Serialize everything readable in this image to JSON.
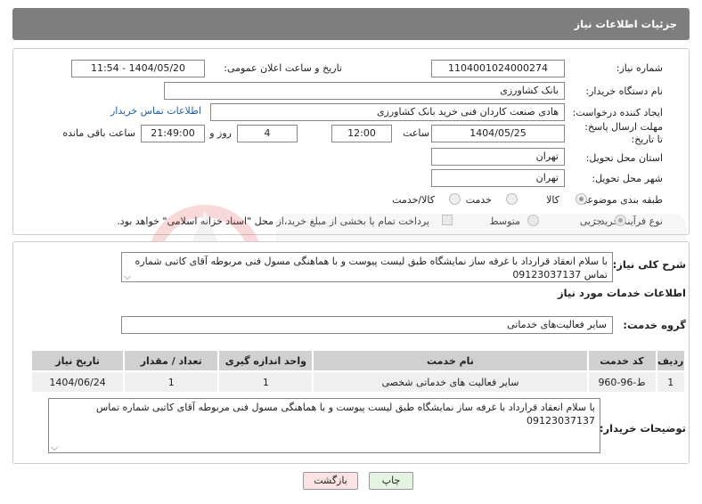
{
  "header": {
    "title": "جزئیات اطلاعات نیاز"
  },
  "form": {
    "need_number_label": "شماره نیاز:",
    "need_number": "1104001024000274",
    "announce_label": "تاریخ و ساعت اعلان عمومی:",
    "announce_value": "1404/05/20 - 11:54",
    "buyer_org_label": "نام دستگاه خریدار:",
    "buyer_org": "بانک کشاورزی",
    "creator_label": "ایجاد کننده درخواست:",
    "creator": "هادی صنعت کاردان فنی خرید بانک کشاورزی",
    "contact_link": "اطلاعات تماس خریدار",
    "deadline_label": "مهلت ارسال پاسخ: تا تاریخ:",
    "deadline_date": "1404/05/25",
    "time_label": "ساعت",
    "deadline_time": "12:00",
    "days_value": "4",
    "days_label": "روز و",
    "remaining_time": "21:49:00",
    "remaining_label": "ساعت باقی مانده",
    "province_label": "استان محل تحویل:",
    "province": "تهران",
    "city_label": "شهر محل تحویل:",
    "city": "تهران",
    "category_label": "طبقه بندی موضوعی:",
    "category_options": [
      "کالا",
      "خدمت",
      "کالا/خدمت"
    ],
    "process_label": "نوع فرآیند خرید :",
    "process_options": [
      "جزیی",
      "متوسط"
    ],
    "payment_note": "پرداخت تمام یا بخشی از مبلغ خرید،از محل \"اسناد خزانه اسلامی\" خواهد بود."
  },
  "details": {
    "desc_label": "شرح کلی نیاز:",
    "desc_text": "با سلام انعقاد قرارداد با غرفه ساز نمایشگاه طبق لیست پیوست و با هماهنگی مسول فنی مربوطه آقای کاتبی شماره تماس 09123037137",
    "services_title": "اطلاعات خدمات مورد نیاز",
    "service_group_label": "گروه خدمت:",
    "service_group": "سایر فعالیت‌های خدماتی",
    "table": {
      "headers": [
        "ردیف",
        "کد خدمت",
        "نام خدمت",
        "واحد اندازه گیری",
        "تعداد / مقدار",
        "تاریخ نیاز"
      ],
      "rows": [
        [
          "1",
          "ط-96-960",
          "سایر فعالیت های خدماتی شخصی",
          "1",
          "1",
          "1404/06/24"
        ]
      ]
    },
    "buyer_notes_label": "توضیحات خریدار:",
    "buyer_notes": "با سلام انعقاد قرارداد با غرفه ساز نمایشگاه طبق لیست پیوست و با هماهنگی مسول فنی مربوطه آقای کاتبی شماره تماس 09123037137"
  },
  "buttons": {
    "print": "چاپ",
    "back": "بازگشت"
  },
  "colors": {
    "header_bg": "#7e7e7e",
    "link": "#1a5fb4",
    "back_bg": "#fbe3e3",
    "print_bg": "#e3f5e1"
  }
}
